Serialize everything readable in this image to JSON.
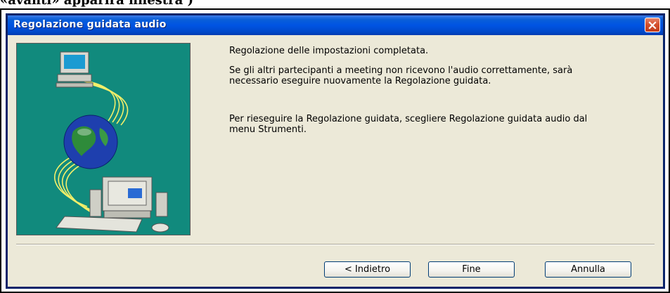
{
  "caption": "«avanti» apparirà finestra )",
  "window": {
    "title": "Regolazione guidata audio"
  },
  "messages": {
    "line1": "Regolazione delle impostazioni completata.",
    "line2": "Se gli altri partecipanti a meeting non ricevono l'audio correttamente, sarà necessario eseguire nuovamente la Regolazione guidata.",
    "line3": "Per rieseguire la Regolazione guidata, scegliere Regolazione guidata audio dal menu Strumenti."
  },
  "buttons": {
    "back": "< Indietro",
    "finish": "Fine",
    "cancel": "Annulla"
  },
  "colors": {
    "titlebar": "#0054e3",
    "dialog_bg": "#ece9d8",
    "illustration_bg": "#118a7d",
    "close_button": "#d5512f"
  },
  "icons": {
    "close": "close-icon",
    "illustration": "network-computers-globe-illustration"
  }
}
